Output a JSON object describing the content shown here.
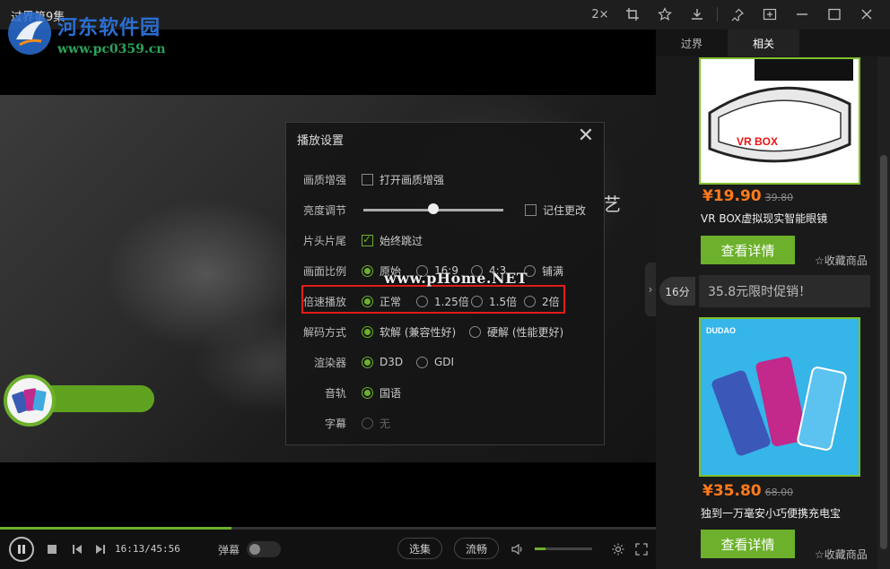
{
  "window": {
    "title": "过界第9集",
    "speed_label": "2×"
  },
  "watermark": {
    "site_name": "河东软件园",
    "url": "www.pc0359.cn"
  },
  "video": {
    "overlay_text": "艺"
  },
  "settings": {
    "title": "播放设置",
    "close_label": "✕",
    "rows": {
      "quality": {
        "label": "画质增强",
        "option": "打开画质增强",
        "checked": false
      },
      "brightness": {
        "label": "亮度调节",
        "remember": "记住更改",
        "remember_checked": false
      },
      "skip": {
        "label": "片头片尾",
        "option": "始终跳过",
        "checked": true
      },
      "ratio": {
        "label": "画面比例",
        "options": [
          "原始",
          "16:9",
          "4:3",
          "铺满"
        ],
        "selected": "原始"
      },
      "speed": {
        "label": "倍速播放",
        "options": [
          "正常",
          "1.25倍",
          "1.5倍",
          "2倍"
        ],
        "selected": "正常"
      },
      "decode": {
        "label": "解码方式",
        "options": [
          "软解 (兼容性好)",
          "硬解 (性能更好)"
        ],
        "selected": "软解 (兼容性好)"
      },
      "renderer": {
        "label": "渲染器",
        "options": [
          "D3D",
          "GDI"
        ],
        "selected": "D3D"
      },
      "audio": {
        "label": "音轨",
        "options": [
          "国语"
        ],
        "selected": "国语"
      },
      "subtitle": {
        "label": "字幕",
        "options": [
          "无"
        ],
        "selected": "无"
      }
    },
    "watermark_text": "www.pHome.NET"
  },
  "controls": {
    "time": "16:13/45:56",
    "danmu_label": "弹幕",
    "select_episode": "选集",
    "quality": "流畅",
    "progress": 0.353,
    "volume": 0.19
  },
  "sidebar": {
    "tabs": [
      "过界",
      "相关"
    ],
    "active_tab": "相关",
    "time_badge": "16分",
    "promo_text": "35.8元限时促销！",
    "products": [
      {
        "price": "¥19.90",
        "old_price": "39.80",
        "name": "VR BOX虚拟现实智能眼镜",
        "button": "查看详情",
        "fav": "☆收藏商品",
        "brand": "VR BOX"
      },
      {
        "price": "¥35.80",
        "old_price": "68.00",
        "name": "独到一万毫安小巧便携充电宝",
        "button": "查看详情",
        "fav": "☆收藏商品",
        "brand": "DUDAO"
      }
    ]
  },
  "colors": {
    "accent": "#6cb02b",
    "price": "#ff7a1a",
    "highlight": "#e21b1b"
  }
}
